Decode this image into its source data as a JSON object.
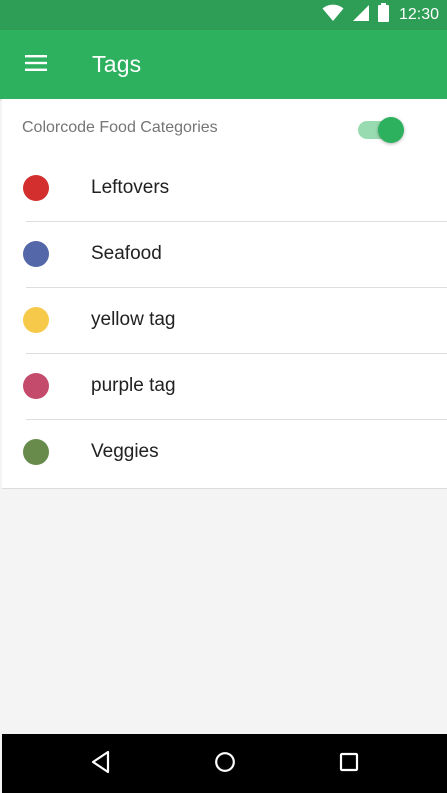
{
  "status_bar": {
    "time": "12:30",
    "icons": [
      "wifi-icon",
      "cell-signal-icon",
      "battery-icon"
    ]
  },
  "app_bar": {
    "menu_icon": "hamburger-menu-icon",
    "title": "Tags",
    "color": "#2eb15f"
  },
  "settings": {
    "colorcode_label": "Colorcode Food Categories",
    "colorcode_enabled": true
  },
  "tags": [
    {
      "name": "Leftovers",
      "color": "#d32f2f"
    },
    {
      "name": "Seafood",
      "color": "#5467a8"
    },
    {
      "name": "yellow tag",
      "color": "#f7c94a"
    },
    {
      "name": "purple tag",
      "color": "#c44b6b"
    },
    {
      "name": "Veggies",
      "color": "#688b4b"
    }
  ],
  "nav_bar": {
    "buttons": [
      "back-icon",
      "home-icon",
      "recents-icon"
    ]
  }
}
